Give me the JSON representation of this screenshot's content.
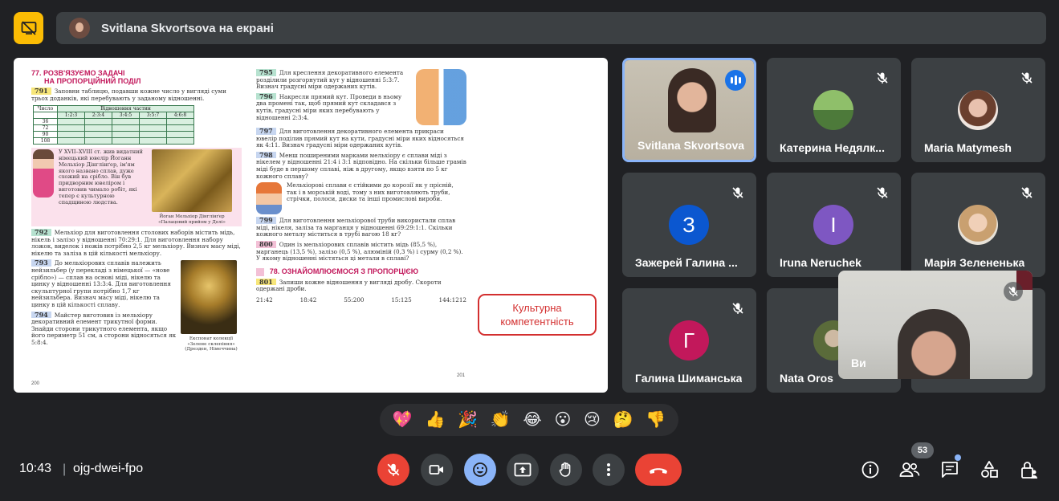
{
  "top_bar": {
    "presenter_label": "Svitlana Skvortsova на екрані"
  },
  "shared_screen": {
    "left_page": {
      "section_number": "77.",
      "section_title_line1": "РОЗВ'ЯЗУЄМО ЗАДАЧІ",
      "section_title_line2": "НА ПРОПОРЦІЙНИЙ ПОДІЛ",
      "task_791_num": "791",
      "task_791": "Заповни таблицю, подавши кожне число у вигляді суми трьох доданків, які перебувають у заданому відношенні.",
      "table_header": [
        "Число",
        "1:2:3",
        "2:3:4",
        "3:4:5",
        "3:5:7",
        "4:6:8"
      ],
      "table_caption": "Відношення частин",
      "table_rows": [
        "36",
        "72",
        "90",
        "108"
      ],
      "story": "У XVII–XVIII ст. жив видатний німецький ювелір Йоганн Мельхіор Дінглінґер, ім'ям якого названо сплав, дуже схожий на срібло. Він був придворним ювеліром і виготовив чимало робіт, які тепер є культурною спадщиною людства.",
      "img1_caption": "Йоган Мельхіор Дінглінґер «Палацовий прийом у Делі»",
      "task_792_num": "792",
      "task_792": "Мельхіор для виготовлення столових наборів містить мідь, нікель і залізо у відношенні 70:29:1. Для виготовлення набору ложок, виделок і ножів потрібно 2,5 кг мельхіору. Визнач масу міді, нікелю та заліза в цій кількості мельхіору.",
      "task_793_num": "793",
      "task_793": "До мельхіорових сплавів належить нейзильбер (у перекладі з німецької — «нове срібло») — сплав на основі міді, нікелю та цинку у відношенні 13:3:4. Для виготовлення скульптурної групи потрібно 1,7 кг нейзильбера. Визнач масу міді, нікелю та цинку в цій кількості сплаву.",
      "img2_caption": "Експонат колекції «Зелене склепіння» (Дрезден, Німеччина)",
      "task_794_num": "794",
      "task_794": "Майстер виготовив із мельхіору декоративний елемент трикутної форми. Знайди сторони трикутного елемента, якщо його периметр 51 см, а сторони відносяться як 5:8:4.",
      "page_number": "200"
    },
    "right_page": {
      "task_795_num": "795",
      "task_795": "Для креслення декоративного елемента розділили розгорнутий кут у відношенні 5:3:7. Визнач градусні міри одержаних кутів.",
      "task_796_num": "796",
      "task_796": "Накресли прямий кут. Проведи в ньому два промені так, щоб прямий кут складався з кутів, градусні міри яких перебувають у відношенні 2:3:4.",
      "task_797_num": "797",
      "task_797": "Для виготовлення декоративного елемента прикраси ювелір поділив прямий кут на кути, градусні міри яких відносяться як 4:11. Визнач градусні міри одержаних кутів.",
      "task_798_num": "798",
      "task_798": "Менш поширеними марками мельхіору є сплави міді з нікелем у відношенні 21:4 і 3:1 відповідно. На скільки більше грамів міді буде в першому сплаві, ніж в другому, якщо взяти по 5 кг кожного сплаву?",
      "note": "Мельхіорові сплави є стійкими до корозії як у прісній, так і в морській воді, тому з них виготовляють труби, стрічки, полоси, диски та інші промислові вироби.",
      "task_799_num": "799",
      "task_799": "Для виготовлення мельхіорової труби використали сплав міді, нікеля, заліза та марганця у відношенні 69:29:1:1. Скільки кожного металу міститься в трубі вагою 18 кг?",
      "task_800_num": "800",
      "task_800": "Один із мельхіорових сплавів містить мідь (85,5 %), марганець (13,5 %), залізо (0,5 %), алюміній (0,3 %) і сурму (0,2 %). У якому відношенні містяться ці метали в сплаві?",
      "section_number": "78.",
      "section_title": "ОЗНАЙОМЛЮЄМОСЯ З ПРОПОРЦІЄЮ",
      "task_801_num": "801",
      "task_801": "Запиши кожне відношення у вигляді дробу. Скороти одержані дроби.",
      "ratios": [
        "21:42",
        "18:42",
        "55:200",
        "15:125",
        "144:1212"
      ],
      "page_number": "201"
    },
    "callout_line1": "Культурна",
    "callout_line2": "компетентність"
  },
  "participants": [
    {
      "name": "Svitlana Skvortsova"
    },
    {
      "name": "Катерина Недялк..."
    },
    {
      "name": "Maria Matymesh"
    },
    {
      "name": "Зажерей Галина ...",
      "initial": "З"
    },
    {
      "name": "Iruna Neruchek",
      "initial": "I"
    },
    {
      "name": "Марія Зелененька"
    },
    {
      "name": "Галина Шиманська",
      "initial": "Г"
    },
    {
      "name": "Nata Oros"
    }
  ],
  "self_tile": {
    "label": "Ви"
  },
  "reactions": [
    "💖",
    "👍",
    "🎉",
    "👏",
    "😂",
    "😮",
    "😢",
    "🤔",
    "👎"
  ],
  "bottom_bar": {
    "time": "10:43",
    "separator": "|",
    "meeting_code": "ojg-dwei-fpo",
    "participant_count": "53"
  },
  "colors": {
    "background": "#202124",
    "present_button": "#fbbc04",
    "end_call": "#ea4335",
    "active_speaker": "#8ab4f8",
    "avatar_z": "#0b57d0",
    "avatar_i": "#7e57c2",
    "avatar_g": "#c2185b"
  }
}
